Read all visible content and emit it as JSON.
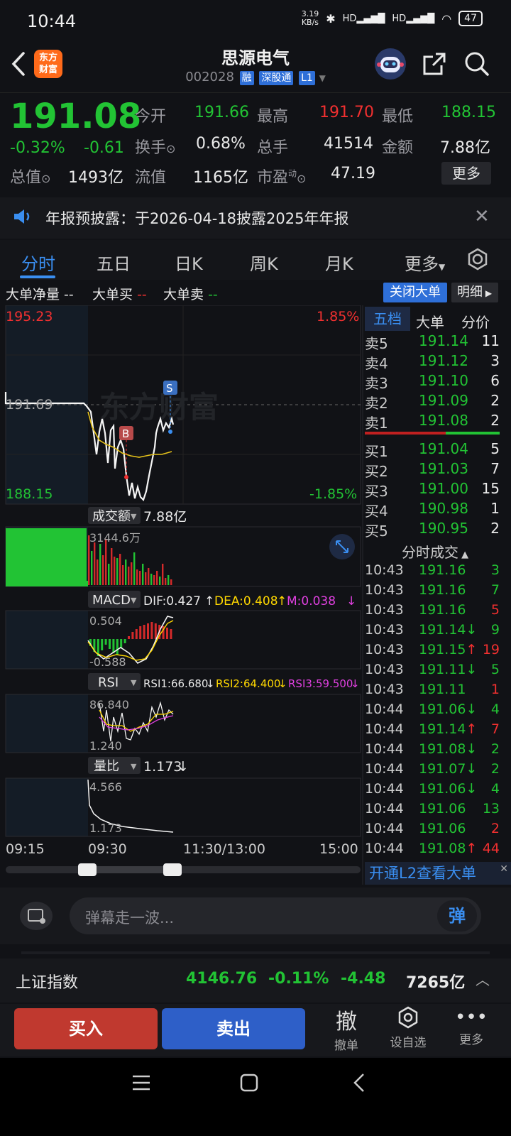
{
  "status": {
    "time": "10:44",
    "net_speed": "3.19\nKB/s",
    "battery": "47",
    "signal1": "HD",
    "signal2": "HD"
  },
  "header": {
    "name": "思源电气",
    "code": "002028",
    "tags": [
      "融",
      "深股通",
      "L1"
    ],
    "logo_text": "东方\n财富"
  },
  "quote": {
    "price": "191.08",
    "change_pct": "-0.32%",
    "change": "-0.61",
    "open_label": "今开",
    "open": "191.66",
    "high_label": "最高",
    "high": "191.70",
    "low_label": "最低",
    "low": "188.15",
    "turnover_label": "换手",
    "turnover": "0.68%",
    "volume_label": "总手",
    "volume": "41514",
    "amount_label": "金额",
    "amount": "7.88亿",
    "mcap_label": "总值",
    "mcap": "1493亿",
    "float_label": "流值",
    "float": "1165亿",
    "pe_label": "市盈",
    "pe_sup": "动",
    "pe": "47.19",
    "more": "更多"
  },
  "notice": {
    "text": "年报预披露：于2026-04-18披露2025年年报"
  },
  "tabs": [
    "分时",
    "五日",
    "日K",
    "周K",
    "月K",
    "更多"
  ],
  "bigorder": {
    "net": "大单净量 --",
    "buy_label": "大单买",
    "buy_val": "--",
    "sell_label": "大单卖",
    "sell_val": "--",
    "close_btn": "关闭大单",
    "detail_btn": "明细"
  },
  "chart": {
    "price_top": "195.23",
    "price_mid": "191.69",
    "price_bot": "188.15",
    "pct_top": "1.85%",
    "pct_bot": "-1.85%",
    "watermark": "东方财富",
    "marker_b": "B",
    "marker_s": "S",
    "amount_label": "成交额",
    "amount_value": "7.88亿",
    "amount_max": "3144.6万",
    "macd_label": "MACD",
    "dif": "DIF:0.427",
    "dea": "DEA:0.408",
    "m": "M:0.038",
    "macd_top": "0.504",
    "macd_bot": "-0.588",
    "rsi_label": "RSI",
    "rsi1": "RSI1:66.680",
    "rsi2": "RSI2:64.400",
    "rsi3": "RSI3:59.500",
    "rsi_top": "86.840",
    "rsi_bot": "1.240",
    "vr_label": "量比",
    "vr_value": "1.173",
    "vr_top": "4.566",
    "vr_bot": "1.173",
    "times": [
      "09:15",
      "09:30",
      "11:30/13:00",
      "15:00"
    ],
    "arrow_down": "↓",
    "arrow_up": "↑"
  },
  "orderbook": {
    "tabs": [
      "五档",
      "大单",
      "分价"
    ],
    "asks": [
      {
        "label": "卖5",
        "price": "191.14",
        "vol": "11"
      },
      {
        "label": "卖4",
        "price": "191.12",
        "vol": "3"
      },
      {
        "label": "卖3",
        "price": "191.10",
        "vol": "6"
      },
      {
        "label": "卖2",
        "price": "191.09",
        "vol": "2"
      },
      {
        "label": "卖1",
        "price": "191.08",
        "vol": "2"
      }
    ],
    "bids": [
      {
        "label": "买1",
        "price": "191.04",
        "vol": "5"
      },
      {
        "label": "买2",
        "price": "191.03",
        "vol": "7"
      },
      {
        "label": "买3",
        "price": "191.00",
        "vol": "15"
      },
      {
        "label": "买4",
        "price": "190.98",
        "vol": "1"
      },
      {
        "label": "买5",
        "price": "190.95",
        "vol": "2"
      }
    ],
    "ticks_title": "分时成交",
    "ticks": [
      {
        "t": "10:43",
        "p": "191.16",
        "v": "3",
        "c": "green"
      },
      {
        "t": "10:43",
        "p": "191.16",
        "v": "7",
        "c": "green"
      },
      {
        "t": "10:43",
        "p": "191.16",
        "v": "5",
        "c": "red"
      },
      {
        "t": "10:43",
        "p": "191.14↓",
        "v": "9",
        "c": "green"
      },
      {
        "t": "10:43",
        "p": "191.15↑",
        "v": "19",
        "c": "red"
      },
      {
        "t": "10:43",
        "p": "191.11↓",
        "v": "5",
        "c": "green"
      },
      {
        "t": "10:43",
        "p": "191.11",
        "v": "1",
        "c": "red"
      },
      {
        "t": "10:44",
        "p": "191.06↓",
        "v": "4",
        "c": "green"
      },
      {
        "t": "10:44",
        "p": "191.14↑",
        "v": "7",
        "c": "red"
      },
      {
        "t": "10:44",
        "p": "191.08↓",
        "v": "2",
        "c": "green"
      },
      {
        "t": "10:44",
        "p": "191.07↓",
        "v": "2",
        "c": "green"
      },
      {
        "t": "10:44",
        "p": "191.06↓",
        "v": "4",
        "c": "green"
      },
      {
        "t": "10:44",
        "p": "191.06",
        "v": "13",
        "c": "green"
      },
      {
        "t": "10:44",
        "p": "191.06",
        "v": "2",
        "c": "red"
      },
      {
        "t": "10:44",
        "p": "191.08↑",
        "v": "44",
        "c": "red"
      }
    ],
    "l2_promo": "开通L2查看大单"
  },
  "danmu": {
    "placeholder": "弹幕走一波...",
    "btn": "弹"
  },
  "index": {
    "name": "上证指数",
    "value": "4146.76",
    "pct": "-0.11%",
    "change": "-4.48",
    "amount": "7265亿"
  },
  "actions": {
    "buy": "买入",
    "sell": "卖出",
    "cancel_icon": "撤",
    "cancel": "撤单",
    "watch": "设自选",
    "more": "更多"
  }
}
